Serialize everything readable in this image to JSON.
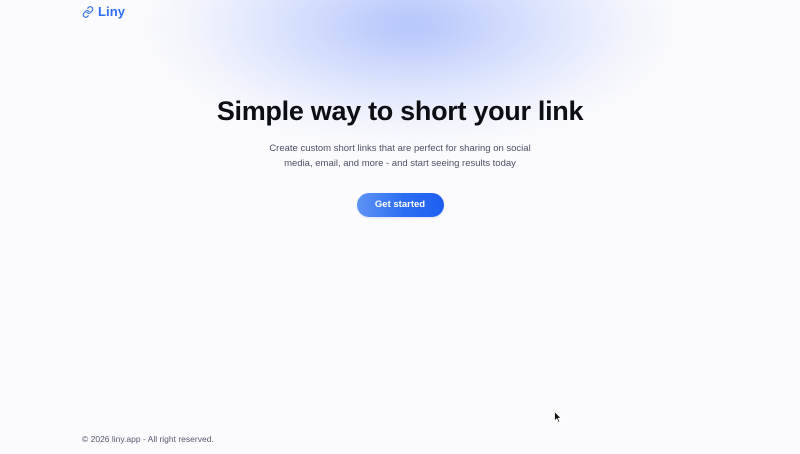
{
  "brand": {
    "name": "Liny",
    "icon": "link-icon",
    "color": "#2f6df6"
  },
  "hero": {
    "title": "Simple way to short your link",
    "subtitle": "Create custom short links that are perfect for sharing on social media, email, and more - and start seeing results today",
    "cta_label": "Get started"
  },
  "footer": {
    "copyright": "© 2026 liny.app - All right reserved."
  },
  "colors": {
    "accent": "#2b6df2",
    "background": "#fbfbfd",
    "glow": "#a5b9fa"
  }
}
